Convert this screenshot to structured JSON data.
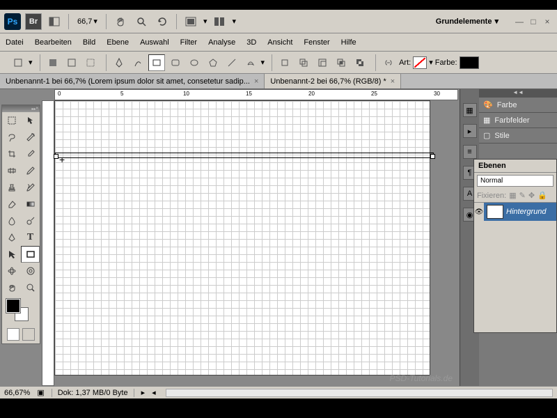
{
  "app": {
    "ps": "Ps",
    "br": "Br"
  },
  "top": {
    "zoom": "66,7",
    "workspace": "Grundelemente"
  },
  "menu": {
    "datei": "Datei",
    "bearbeiten": "Bearbeiten",
    "bild": "Bild",
    "ebene": "Ebene",
    "auswahl": "Auswahl",
    "filter": "Filter",
    "analyse": "Analyse",
    "dreid": "3D",
    "ansicht": "Ansicht",
    "fenster": "Fenster",
    "hilfe": "Hilfe"
  },
  "opt": {
    "art": "Art:",
    "farbe": "Farbe:"
  },
  "tabs": {
    "t1": "Unbenannt-1 bei 66,7% (Lorem ipsum dolor sit amet, consetetur sadip...",
    "t2": "Unbenannt-2 bei 66,7% (RGB/8) *"
  },
  "panels": {
    "farbe": "Farbe",
    "farbfelder": "Farbfelder",
    "stile": "Stile",
    "ebenen": "Ebenen"
  },
  "layers": {
    "blend": "Normal",
    "fix": "Fixieren:",
    "bg": "Hintergrund"
  },
  "ruler": {
    "r0": "0",
    "r5": "5",
    "r10": "10",
    "r15": "15",
    "r20": "20",
    "r25": "25",
    "r30": "30"
  },
  "status": {
    "zoom": "66,67%",
    "doc": "Dok: 1,37 MB/0 Byte"
  },
  "watermark": "PSD-Tutorials.de"
}
